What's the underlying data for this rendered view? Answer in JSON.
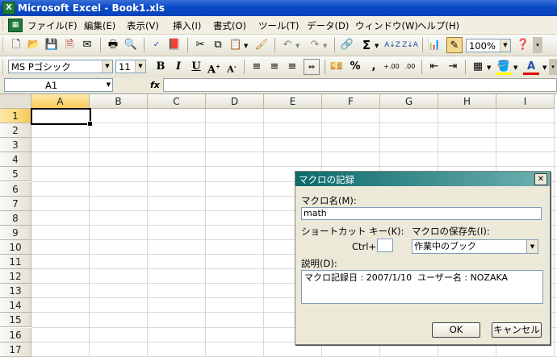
{
  "window": {
    "title": "Microsoft Excel - Book1.xls",
    "app_icon": "X"
  },
  "menu": [
    "ファイル(F)",
    "編集(E)",
    "表示(V)",
    "挿入(I)",
    "書式(O)",
    "ツール(T)",
    "データ(D)",
    "ウィンドウ(W)",
    "ヘルプ(H)"
  ],
  "toolbar_standard": {
    "zoom": "100%"
  },
  "toolbar_format": {
    "font": "MS Pゴシック",
    "size": "11"
  },
  "formula_bar": {
    "name_box": "A1",
    "fx_label": "fx",
    "content": ""
  },
  "columns": [
    "A",
    "B",
    "C",
    "D",
    "E",
    "F",
    "G",
    "H",
    "I"
  ],
  "rows": [
    "1",
    "2",
    "3",
    "4",
    "5",
    "6",
    "7",
    "8",
    "9",
    "10",
    "11",
    "12",
    "13",
    "14",
    "15",
    "16",
    "17"
  ],
  "dialog": {
    "title": "マクロの記録",
    "macro_name_label": "マクロ名(M):",
    "macro_name_value": "math",
    "shortcut_label": "ショートカット キー(K):",
    "ctrl_label": "Ctrl+",
    "shortcut_value": "",
    "store_label": "マクロの保存先(I):",
    "store_value": "作業中のブック",
    "description_label": "説明(D):",
    "description_value": "マクロ記録日 : 2007/1/10  ユーザー名 : NOZAKA",
    "ok_label": "OK",
    "cancel_label": "キャンセル",
    "close_glyph": "✕"
  }
}
